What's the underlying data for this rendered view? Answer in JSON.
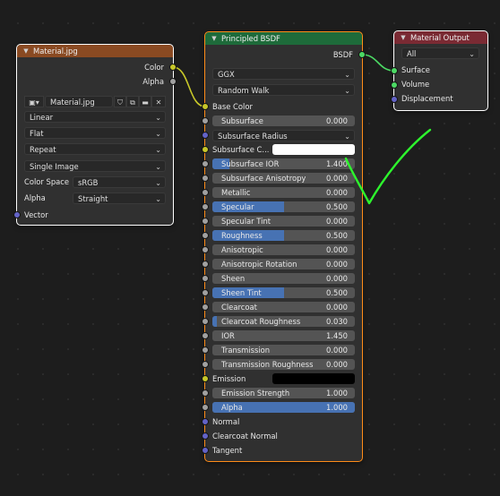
{
  "colors": {
    "color_socket": "#c7c729",
    "shader_socket": "#4cd964",
    "vector_socket": "#6363c7",
    "float_socket": "#a1a1a1",
    "image_header": "#8a4a22",
    "shader_header": "#1e6b3a",
    "output_header": "#7a2a33",
    "accent_fill": "#4772b3",
    "check_mark": "#2df52d"
  },
  "image_node": {
    "title": "Material.jpg",
    "outputs": [
      "Color",
      "Alpha"
    ],
    "file_icon": "image-icon",
    "image_name": "Material.jpg",
    "dropdowns": [
      "Linear",
      "Flat",
      "Repeat",
      "Single Image"
    ],
    "color_space": {
      "label": "Color Space",
      "value": "sRGB"
    },
    "alpha": {
      "label": "Alpha",
      "value": "Straight"
    },
    "input": "Vector"
  },
  "bsdf_node": {
    "title": "Principled BSDF",
    "output": "BSDF",
    "distribution": "GGX",
    "subsurface_method": "Random Walk",
    "base_color": "Base Color",
    "subsurface": {
      "name": "Subsurface",
      "value": "0.000",
      "fill": 0
    },
    "subsurface_radius": "Subsurface Radius",
    "subsurface_color": "Subsurface C...",
    "fields": [
      {
        "name": "Subsurface IOR",
        "value": "1.400",
        "fill": 0.12
      },
      {
        "name": "Subsurface Anisotropy",
        "value": "0.000",
        "fill": 0
      },
      {
        "name": "Metallic",
        "value": "0.000",
        "fill": 0
      },
      {
        "name": "Specular",
        "value": "0.500",
        "fill": 0.5
      },
      {
        "name": "Specular Tint",
        "value": "0.000",
        "fill": 0
      },
      {
        "name": "Roughness",
        "value": "0.500",
        "fill": 0.5
      },
      {
        "name": "Anisotropic",
        "value": "0.000",
        "fill": 0
      },
      {
        "name": "Anisotropic Rotation",
        "value": "0.000",
        "fill": 0
      },
      {
        "name": "Sheen",
        "value": "0.000",
        "fill": 0
      },
      {
        "name": "Sheen Tint",
        "value": "0.500",
        "fill": 0.5
      },
      {
        "name": "Clearcoat",
        "value": "0.000",
        "fill": 0
      },
      {
        "name": "Clearcoat Roughness",
        "value": "0.030",
        "fill": 0.03
      },
      {
        "name": "IOR",
        "value": "1.450",
        "fill": 0
      },
      {
        "name": "Transmission",
        "value": "0.000",
        "fill": 0
      },
      {
        "name": "Transmission Roughness",
        "value": "0.000",
        "fill": 0
      }
    ],
    "emission": "Emission",
    "emission_strength": {
      "name": "Emission Strength",
      "value": "1.000",
      "fill": 0
    },
    "alpha": {
      "name": "Alpha",
      "value": "1.000",
      "fill": 1
    },
    "vectors": [
      "Normal",
      "Clearcoat Normal",
      "Tangent"
    ]
  },
  "output_node": {
    "title": "Material Output",
    "target": "All",
    "inputs": [
      "Surface",
      "Volume",
      "Displacement"
    ]
  }
}
